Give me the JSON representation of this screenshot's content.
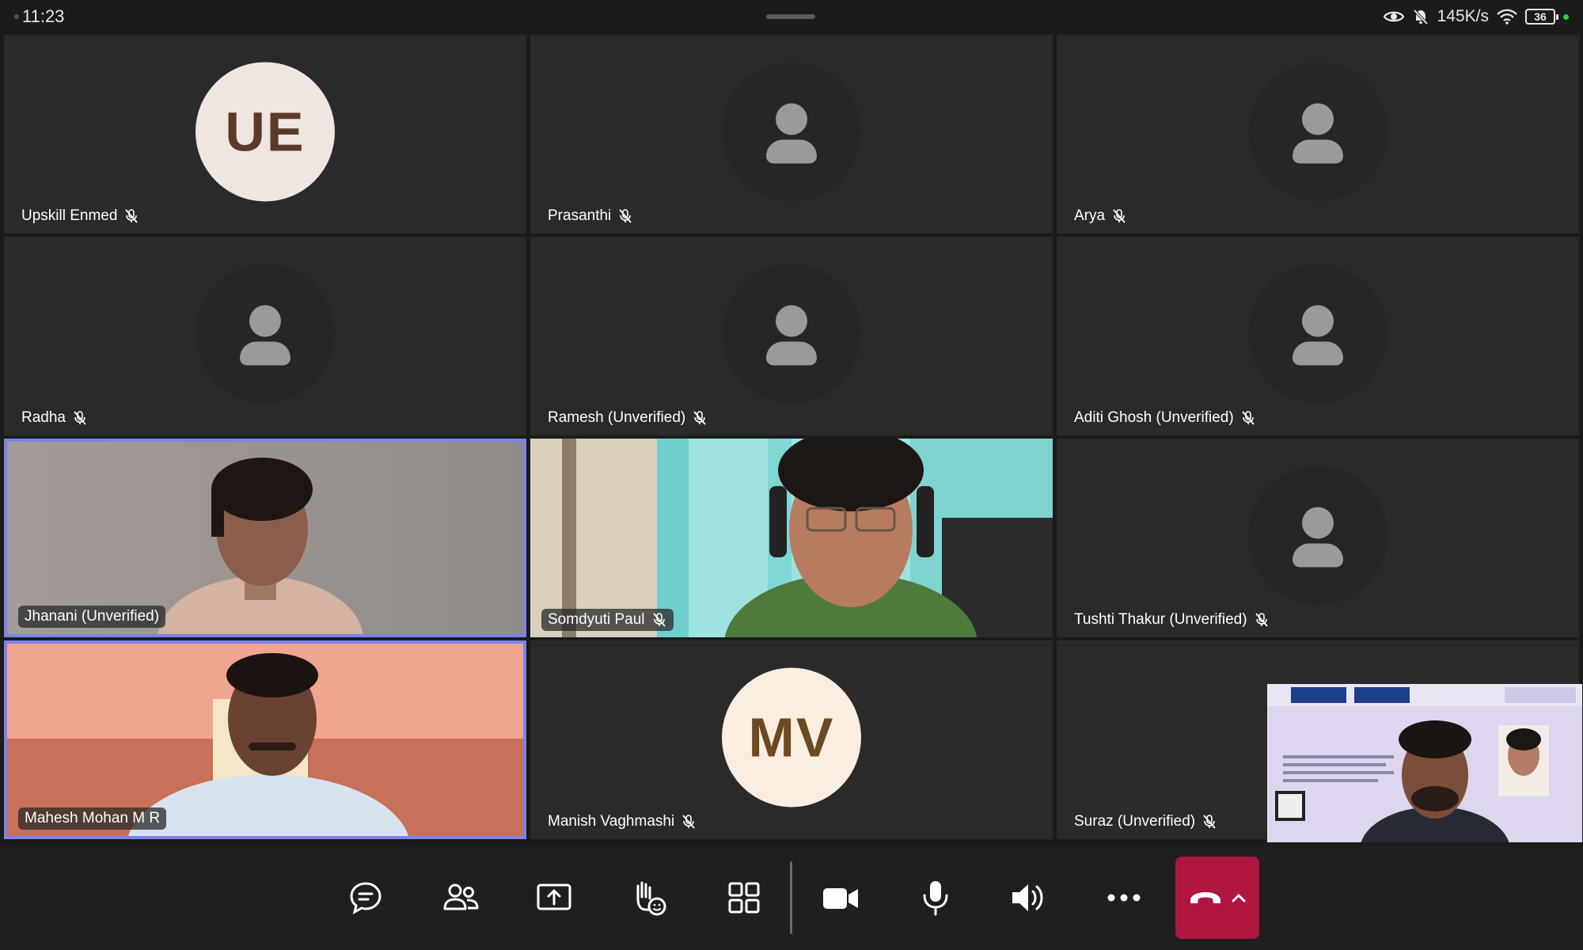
{
  "status_bar": {
    "time": "11:23",
    "network_speed": "145K/s",
    "battery_level": "36",
    "icons": [
      "eye-icon",
      "bell-off-icon",
      "wifi-icon",
      "battery-icon"
    ]
  },
  "participants": [
    {
      "name": "Upskill Enmed",
      "kind": "initials",
      "initials": "UE",
      "avatar_bg": "#f0e6e1",
      "avatar_fg": "#5b3a29",
      "muted": true
    },
    {
      "name": "Prasanthi",
      "kind": "placeholder",
      "muted": true
    },
    {
      "name": "Arya",
      "kind": "placeholder",
      "muted": true
    },
    {
      "name": "Radha",
      "kind": "placeholder",
      "muted": true
    },
    {
      "name": "Ramesh (Unverified)",
      "kind": "placeholder",
      "muted": true
    },
    {
      "name": "Aditi Ghosh (Unverified)",
      "kind": "placeholder",
      "muted": true
    },
    {
      "name": "Jhanani (Unverified)",
      "kind": "video",
      "muted": false,
      "speaking": true
    },
    {
      "name": "Somdyuti  Paul",
      "kind": "video",
      "muted": true
    },
    {
      "name": "Tushti Thakur (Unverified)",
      "kind": "placeholder",
      "muted": true
    },
    {
      "name": "Mahesh Mohan M R",
      "kind": "video",
      "muted": false,
      "speaking": true
    },
    {
      "name": "Manish Vaghmashi",
      "kind": "initials",
      "initials": "MV",
      "avatar_bg": "#fbeee0",
      "avatar_fg": "#6b4a22",
      "muted": true
    },
    {
      "name": "Suraz (Unverified)",
      "kind": "placeholder",
      "muted": true
    }
  ],
  "toolbar": {
    "buttons": [
      {
        "name": "chat-button",
        "icon": "chat-icon"
      },
      {
        "name": "people-button",
        "icon": "people-icon"
      },
      {
        "name": "share-button",
        "icon": "share-screen-icon"
      },
      {
        "name": "raise-hand-button",
        "icon": "raise-hand-icon"
      },
      {
        "name": "view-button",
        "icon": "grid-view-icon"
      },
      {
        "name": "camera-button",
        "icon": "video-camera-icon"
      },
      {
        "name": "mic-button",
        "icon": "microphone-icon"
      },
      {
        "name": "speaker-button",
        "icon": "speaker-icon"
      },
      {
        "name": "more-button",
        "icon": "more-icon"
      }
    ],
    "leave": {
      "icon": "hang-up-icon",
      "color": "#b0163f"
    }
  },
  "accent_color": "#7b83eb"
}
